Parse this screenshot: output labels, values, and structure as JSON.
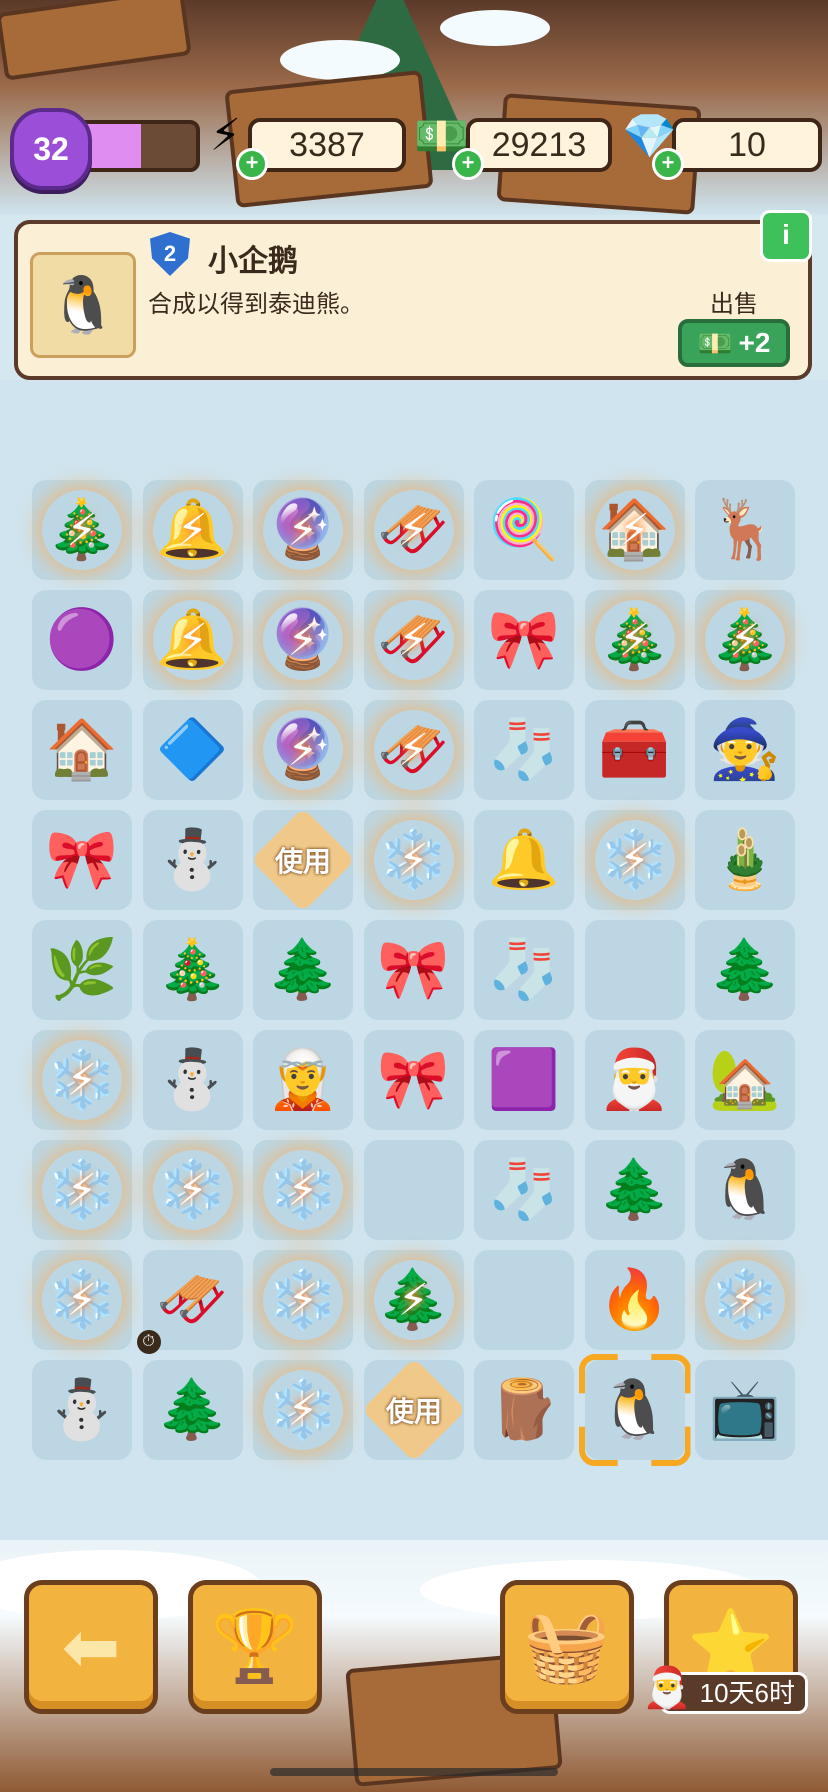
{
  "hud": {
    "level": "32",
    "xp_fraction": 0.55,
    "energy": "3387",
    "energy_icon": "⚡",
    "cash": "29213",
    "cash_icon": "💵",
    "gems": "10",
    "gem_icon": "💎",
    "plus": "+"
  },
  "info": {
    "item_level": "2",
    "item_name": "小企鹅",
    "item_desc": "合成以得到泰迪熊。",
    "thumb": "🐧",
    "info_icon": "i",
    "sell_label": "出售",
    "sell_icon": "💵",
    "sell_value": "+2"
  },
  "bolt": "⚡",
  "board": [
    {
      "glyph": "🎄",
      "energized": true
    },
    {
      "glyph": "🔔",
      "energized": true
    },
    {
      "glyph": "🔮",
      "energized": true
    },
    {
      "glyph": "🛷",
      "energized": true
    },
    {
      "glyph": "🍭",
      "energized": false
    },
    {
      "glyph": "🏠",
      "energized": true
    },
    {
      "glyph": "🦌",
      "energized": false
    },
    {
      "glyph": "🟣",
      "energized": false
    },
    {
      "glyph": "🔔",
      "energized": true
    },
    {
      "glyph": "🔮",
      "energized": true
    },
    {
      "glyph": "🛷",
      "energized": true
    },
    {
      "glyph": "🎀",
      "energized": false
    },
    {
      "glyph": "🎄",
      "energized": true
    },
    {
      "glyph": "🎄",
      "energized": true
    },
    {
      "glyph": "🏠",
      "energized": false
    },
    {
      "glyph": "🔷",
      "energized": false
    },
    {
      "glyph": "🔮",
      "energized": true
    },
    {
      "glyph": "🛷",
      "energized": true
    },
    {
      "glyph": "🧦",
      "energized": false
    },
    {
      "glyph": "🧰",
      "energized": false
    },
    {
      "glyph": "🧙",
      "energized": false
    },
    {
      "glyph": "🎀",
      "energized": false
    },
    {
      "glyph": "⛄",
      "energized": false
    },
    {
      "use": "使用"
    },
    {
      "glyph": "❄️",
      "energized": true
    },
    {
      "glyph": "🔔",
      "energized": false
    },
    {
      "glyph": "❄️",
      "energized": true
    },
    {
      "glyph": "🎍",
      "energized": false
    },
    {
      "glyph": "🌿",
      "energized": false
    },
    {
      "glyph": "🎄",
      "energized": false
    },
    {
      "glyph": "🌲",
      "energized": false
    },
    {
      "glyph": "🎀",
      "energized": false
    },
    {
      "glyph": "🧦",
      "energized": false
    },
    {
      "glyph": "",
      "energized": false
    },
    {
      "glyph": "🌲",
      "energized": false
    },
    {
      "glyph": "❄️",
      "energized": true
    },
    {
      "glyph": "⛄",
      "energized": false
    },
    {
      "glyph": "🧝",
      "energized": false
    },
    {
      "glyph": "🎀",
      "energized": false
    },
    {
      "glyph": "🟪",
      "energized": false
    },
    {
      "glyph": "🎅",
      "energized": false
    },
    {
      "glyph": "🏡",
      "energized": false
    },
    {
      "glyph": "❄️",
      "energized": true
    },
    {
      "glyph": "❄️",
      "energized": true
    },
    {
      "glyph": "❄️",
      "energized": true
    },
    {
      "glyph": "",
      "energized": false
    },
    {
      "glyph": "🧦",
      "energized": false
    },
    {
      "glyph": "🌲",
      "energized": false
    },
    {
      "glyph": "🐧",
      "energized": false
    },
    {
      "glyph": "❄️",
      "energized": true
    },
    {
      "glyph": "🛷",
      "energized": false,
      "timer": "⏱"
    },
    {
      "glyph": "❄️",
      "energized": true
    },
    {
      "glyph": "🌲",
      "energized": true
    },
    {
      "glyph": "",
      "energized": false
    },
    {
      "glyph": "🔥",
      "energized": false
    },
    {
      "glyph": "❄️",
      "energized": true
    },
    {
      "glyph": "⛄",
      "energized": false
    },
    {
      "glyph": "🌲",
      "energized": false
    },
    {
      "glyph": "❄️",
      "energized": true
    },
    {
      "use": "使用"
    },
    {
      "glyph": "🪵",
      "energized": false
    },
    {
      "glyph": "🐧",
      "energized": false,
      "selected": true
    },
    {
      "glyph": "📺",
      "energized": false
    }
  ],
  "toolbar": {
    "back_icon": "⬅",
    "leaderboard_icon": "🏆",
    "basket_icon": "🧺",
    "event_icon": "⭐",
    "event_timer": "10天6时",
    "hat_icon": "🎅"
  }
}
